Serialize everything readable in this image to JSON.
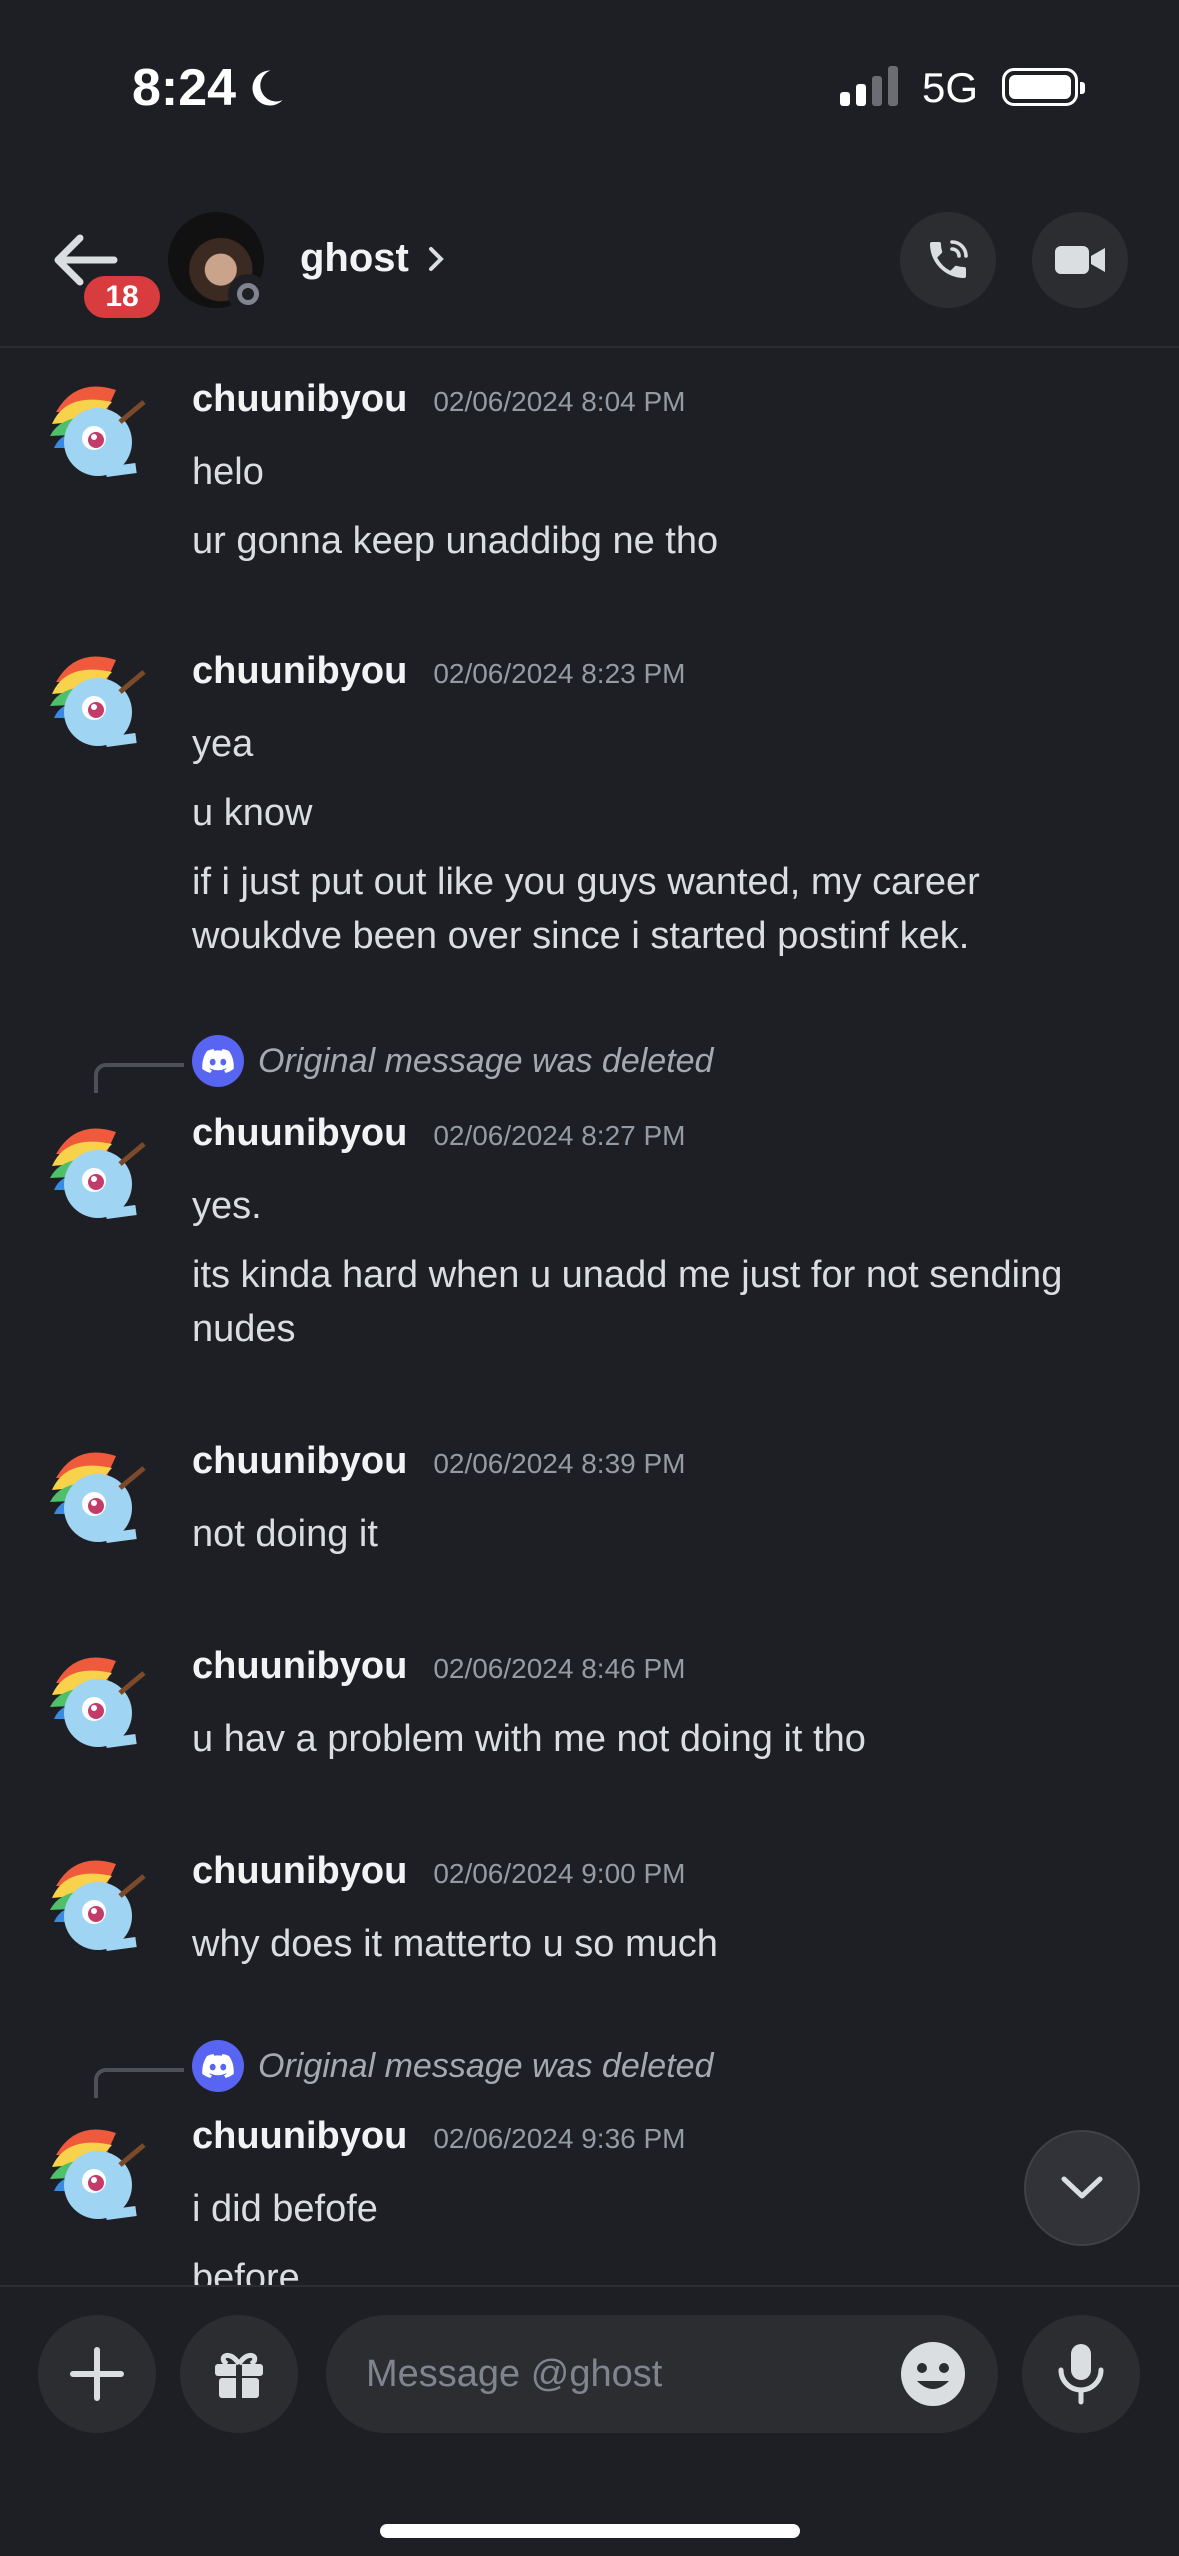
{
  "status_bar": {
    "time": "8:24",
    "network": "5G"
  },
  "header": {
    "badge_count": "18",
    "name": "ghost"
  },
  "reply_preview_text": "Original message was deleted",
  "messages": [
    {
      "username": "chuunibyou",
      "timestamp": "02/06/2024 8:04 PM",
      "lines": [
        "helo",
        "ur gonna keep unaddibg ne tho"
      ]
    },
    {
      "username": "chuunibyou",
      "timestamp": "02/06/2024 8:23 PM",
      "lines": [
        "yea",
        "u know",
        "if i just put out like you guys wanted, my career",
        "woukdve been over since i started postinf kek."
      ]
    },
    {
      "username": "chuunibyou",
      "timestamp": "02/06/2024 8:27 PM",
      "lines": [
        "yes.",
        "its kinda hard when u unadd me just for not sending",
        "nudes"
      ]
    },
    {
      "username": "chuunibyou",
      "timestamp": "02/06/2024 8:39 PM",
      "lines": [
        "not doing it"
      ]
    },
    {
      "username": "chuunibyou",
      "timestamp": "02/06/2024 8:46 PM",
      "lines": [
        "u hav a problem with me not doing it tho"
      ]
    },
    {
      "username": "chuunibyou",
      "timestamp": "02/06/2024 9:00 PM",
      "lines": [
        "why does it matterto u so much"
      ]
    },
    {
      "username": "chuunibyou",
      "timestamp": "02/06/2024 9:36 PM",
      "lines": [
        "i did befofe",
        "before"
      ]
    }
  ],
  "composer": {
    "placeholder": "Message @ghost"
  },
  "colors": {
    "background": "#1e1f24",
    "accent": "#5865f2",
    "badge": "#d83c3e"
  }
}
